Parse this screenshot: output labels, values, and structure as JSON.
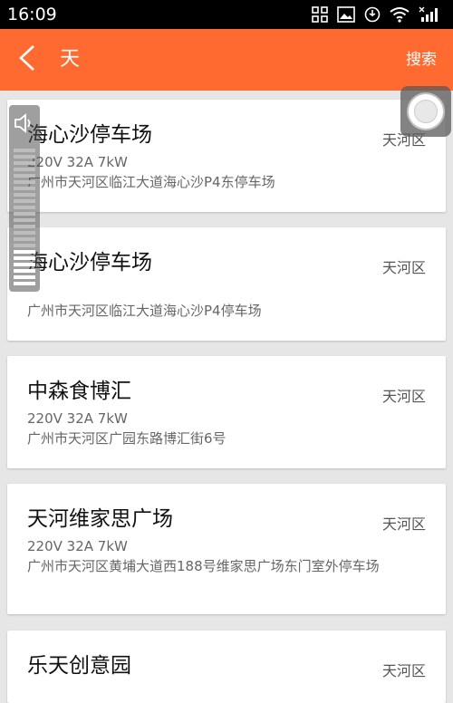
{
  "status_bar": {
    "time": "16:09",
    "icons": [
      "grid-icon",
      "image-icon",
      "sync-icon",
      "wifi-icon",
      "signal-icon"
    ]
  },
  "header": {
    "back_icon": "chevron-left-icon",
    "search_query": "天",
    "search_label": "搜索",
    "background_color": "#ff6a30"
  },
  "results": [
    {
      "name": "海心沙停车场",
      "district": "天河区",
      "spec": "220V 32A 7kW",
      "address": "广州市天河区临江大道海心沙P4东停车场"
    },
    {
      "name": "海心沙停车场",
      "district": "天河区",
      "spec": "",
      "address": "广州市天河区临江大道海心沙P4停车场"
    },
    {
      "name": "中森食博汇",
      "district": "天河区",
      "spec": "220V 32A 7kW",
      "address": "广州市天河区广园东路博汇街6号"
    },
    {
      "name": "天河维家思广场",
      "district": "天河区",
      "spec": "220V 32A 7kW",
      "address": "广州市天河区黄埔大道西188号维家思广场东门室外停车场"
    },
    {
      "name": "乐天创意园",
      "district": "天河区",
      "spec": "",
      "address": ""
    }
  ],
  "overlays": {
    "volume_icon": "speaker-icon",
    "volume_level": 0.25,
    "assistive_icon": "assistive-touch-icon"
  }
}
